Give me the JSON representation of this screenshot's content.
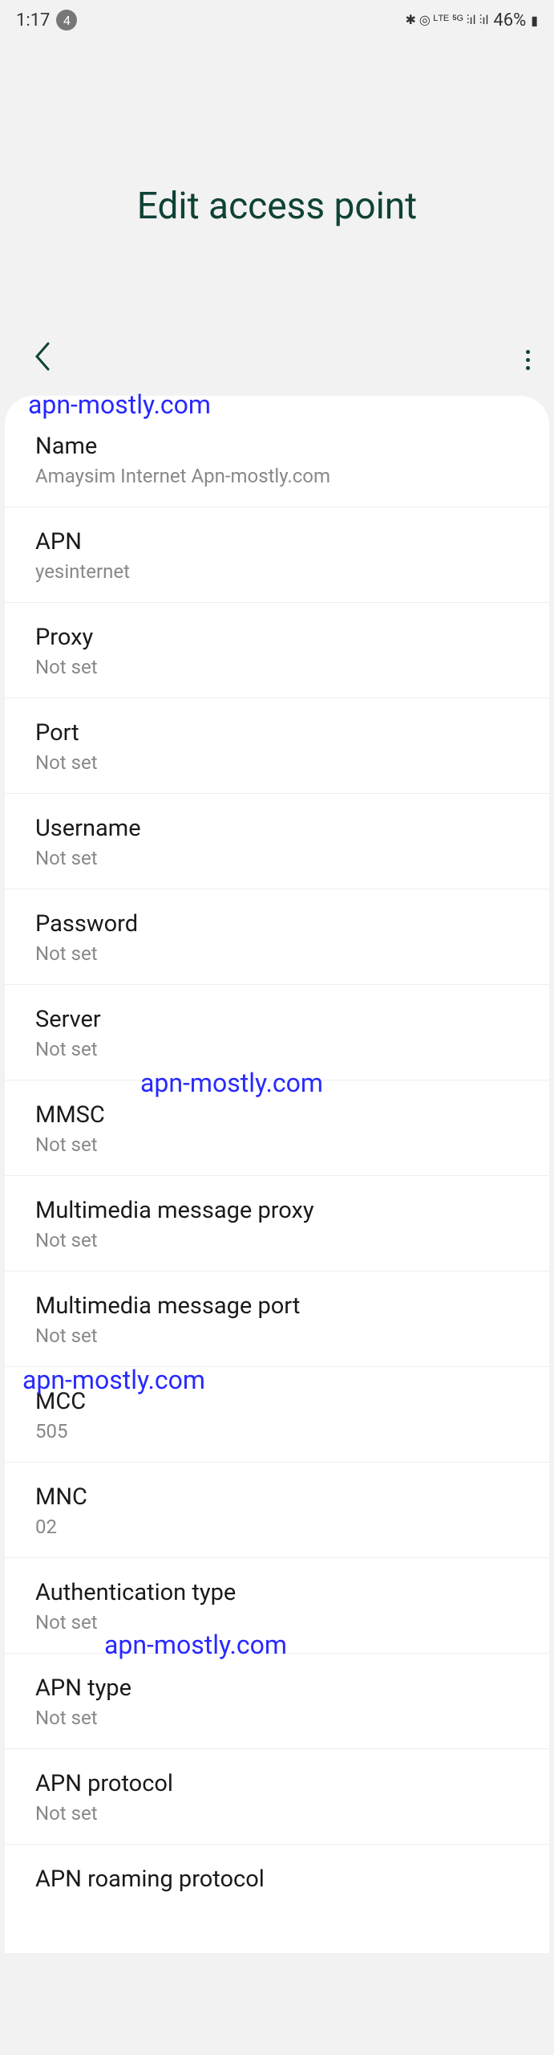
{
  "status": {
    "time": "1:17",
    "notif_count": "4",
    "battery": "46%",
    "icons": "✱ ◎ ᴸᵀᴱ ⁵ᴳ ⫶ıl ⫶ıl"
  },
  "header": {
    "title": "Edit access point"
  },
  "watermarks": {
    "w1": "apn-mostly.com",
    "w2": "apn-mostly.com",
    "w3": "apn-mostly.com",
    "w4": "apn-mostly.com"
  },
  "settings": [
    {
      "label": "Name",
      "value": "Amaysim Internet Apn-mostly.com"
    },
    {
      "label": "APN",
      "value": "yesinternet"
    },
    {
      "label": "Proxy",
      "value": "Not set"
    },
    {
      "label": "Port",
      "value": "Not set"
    },
    {
      "label": "Username",
      "value": "Not set"
    },
    {
      "label": "Password",
      "value": "Not set"
    },
    {
      "label": "Server",
      "value": "Not set"
    },
    {
      "label": "MMSC",
      "value": "Not set"
    },
    {
      "label": "Multimedia message proxy",
      "value": "Not set"
    },
    {
      "label": "Multimedia message port",
      "value": "Not set"
    },
    {
      "label": "MCC",
      "value": "505"
    },
    {
      "label": "MNC",
      "value": "02"
    },
    {
      "label": "Authentication type",
      "value": "Not set"
    },
    {
      "label": "APN type",
      "value": "Not set"
    },
    {
      "label": "APN protocol",
      "value": "Not set"
    },
    {
      "label": "APN roaming protocol",
      "value": ""
    }
  ]
}
